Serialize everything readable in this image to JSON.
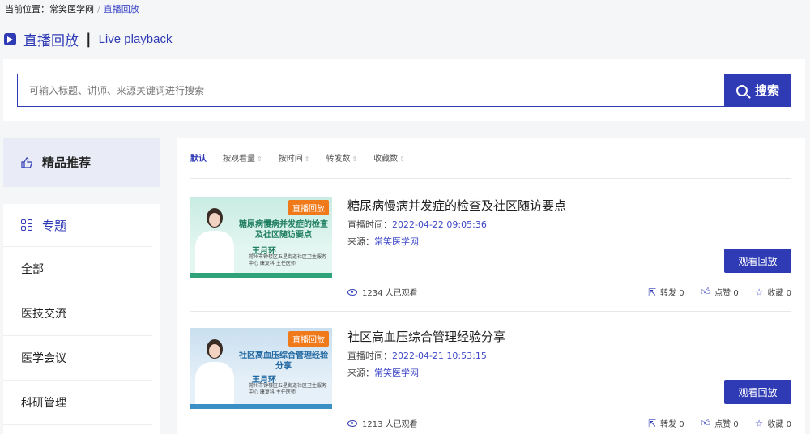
{
  "breadcrumb": {
    "prefix": "当前位置：",
    "home": "常笑医学网",
    "separator": "/",
    "current": "直播回放"
  },
  "page_title": {
    "cn": "直播回放",
    "separator": "|",
    "en": "Live playback"
  },
  "search": {
    "placeholder": "可输入标题、讲师、来源关键词进行搜索",
    "button_label": "搜索"
  },
  "sidebar": {
    "featured_label": "精品推荐",
    "topic_label": "专题",
    "items": [
      "全部",
      "医技交流",
      "医学会议",
      "科研管理"
    ]
  },
  "sort": {
    "options": [
      {
        "label": "默认",
        "active": true,
        "arrow": ""
      },
      {
        "label": "按观看量",
        "active": false,
        "arrow": "⇕"
      },
      {
        "label": "按时间",
        "active": false,
        "arrow": "⇕"
      },
      {
        "label": "转发数",
        "active": false,
        "arrow": "⇕"
      },
      {
        "label": "收藏数",
        "active": false,
        "arrow": "⇕"
      }
    ]
  },
  "videos": [
    {
      "title": "糖尿病慢病并发症的检查及社区随访要点",
      "time_label": "直播时间：",
      "time": "2022-04-22 09:05:36",
      "source_label": "来源：",
      "source": "常笑医学网",
      "watch_label": "观看回放",
      "views": "1234 人已观看",
      "share": "转发 0",
      "like": "点赞 0",
      "fav": "收藏 0",
      "cover": {
        "badge": "直播回放",
        "title": "糖尿病慢病并发症的检查及社区随访要点",
        "name": "王月环",
        "org": "常州市钟楼区五星街道社区卫生服务中心 康复科 主任医师"
      }
    },
    {
      "title": "社区高血压综合管理经验分享",
      "time_label": "直播时间：",
      "time": "2022-04-21 10:53:15",
      "source_label": "来源：",
      "source": "常笑医学网",
      "watch_label": "观看回放",
      "views": "1213 人已观看",
      "share": "转发 0",
      "like": "点赞 0",
      "fav": "收藏 0",
      "cover": {
        "badge": "直播回放",
        "title": "社区高血压综合管理经验分享",
        "name": "王月环",
        "org": "常州市钟楼区五星街道社区卫生服务中心 康复科 主任医师"
      }
    }
  ]
}
